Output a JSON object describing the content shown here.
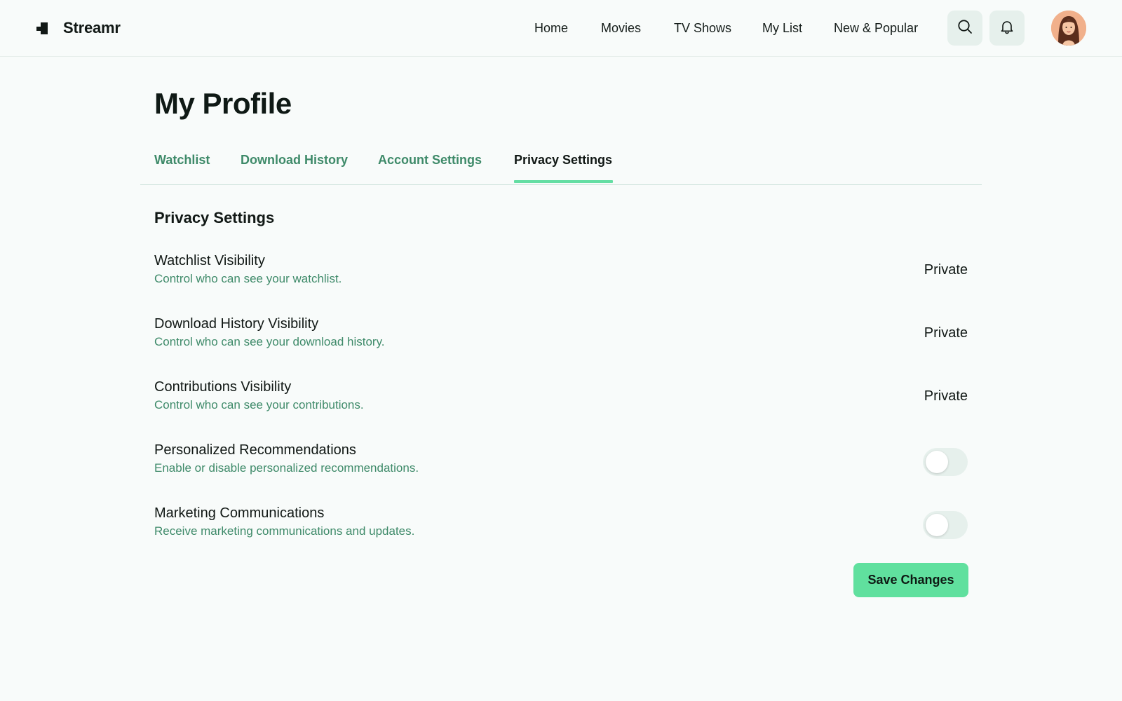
{
  "app": {
    "name": "Streamr"
  },
  "nav": {
    "links": [
      {
        "label": "Home"
      },
      {
        "label": "Movies"
      },
      {
        "label": "TV Shows"
      },
      {
        "label": "My List"
      },
      {
        "label": "New & Popular"
      }
    ],
    "icons": [
      "search-icon",
      "bell-icon"
    ]
  },
  "page": {
    "title": "My Profile"
  },
  "tabs": [
    {
      "label": "Watchlist",
      "active": false
    },
    {
      "label": "Download History",
      "active": false
    },
    {
      "label": "Account Settings",
      "active": false
    },
    {
      "label": "Privacy Settings",
      "active": true
    }
  ],
  "section": {
    "title": "Privacy Settings"
  },
  "settings": [
    {
      "label": "Watchlist Visibility",
      "description": "Control who can see your watchlist.",
      "type": "select",
      "value": "Private"
    },
    {
      "label": "Download History Visibility",
      "description": "Control who can see your download history.",
      "type": "select",
      "value": "Private"
    },
    {
      "label": "Contributions Visibility",
      "description": "Control who can see your contributions.",
      "type": "select",
      "value": "Private"
    },
    {
      "label": "Personalized Recommendations",
      "description": "Enable or disable personalized recommendations.",
      "type": "toggle",
      "enabled": false
    },
    {
      "label": "Marketing Communications",
      "description": "Receive marketing communications and updates.",
      "type": "toggle",
      "enabled": false
    }
  ],
  "actions": {
    "save_label": "Save Changes"
  },
  "colors": {
    "accent": "#60e09e",
    "link_green": "#3e8a69",
    "background": "#f8fbfa",
    "chip": "#e6f0ec"
  }
}
